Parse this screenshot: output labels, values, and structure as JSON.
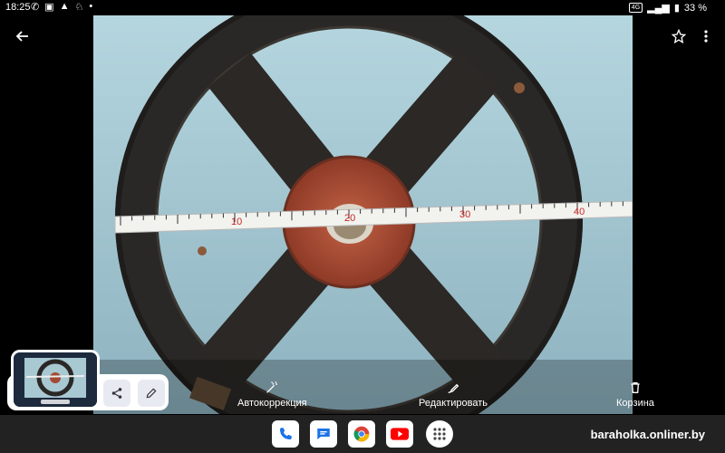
{
  "status": {
    "time": "18:25",
    "battery": "33 %",
    "volte": "4G"
  },
  "photo_actions": [
    {
      "label": "Автокоррекция"
    },
    {
      "label": "Редактировать"
    },
    {
      "label": "Корзина"
    }
  ],
  "tape_numbers": [
    "10",
    "20",
    "30",
    "40"
  ],
  "watermark": "baraholka.onliner.by",
  "taskbar_apps": [
    "phone-icon",
    "messages-icon",
    "chrome-icon",
    "youtube-icon",
    "app-drawer-icon"
  ]
}
